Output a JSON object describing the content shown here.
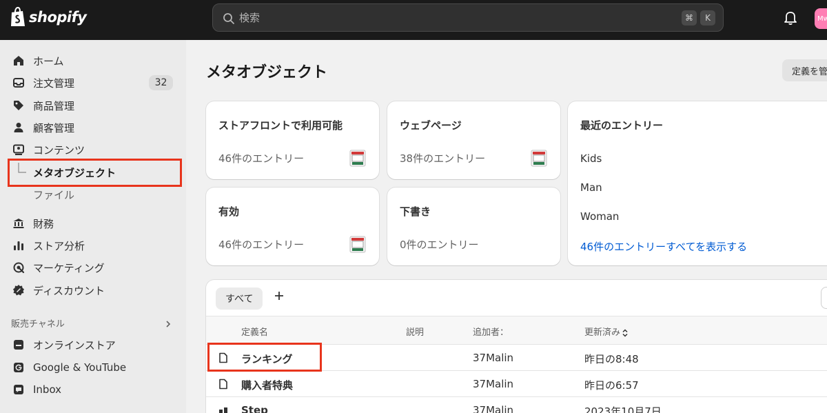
{
  "topbar": {
    "logo_text": "shopify",
    "search_placeholder": "検索",
    "shortcut_cmd": "⌘",
    "shortcut_key": "K",
    "avatar_text": "Mw"
  },
  "sidebar": {
    "items": [
      {
        "label": "ホーム",
        "icon": "home-icon"
      },
      {
        "label": "注文管理",
        "icon": "inbox-icon",
        "badge": "32"
      },
      {
        "label": "商品管理",
        "icon": "tag-icon"
      },
      {
        "label": "顧客管理",
        "icon": "person-icon"
      },
      {
        "label": "コンテンツ",
        "icon": "content-icon"
      },
      {
        "label": "メタオブジェクト"
      },
      {
        "label": "ファイル"
      },
      {
        "label": "財務",
        "icon": "bank-icon"
      },
      {
        "label": "ストア分析",
        "icon": "bar-chart-icon"
      },
      {
        "label": "マーケティング",
        "icon": "target-icon"
      },
      {
        "label": "ディスカウント",
        "icon": "discount-icon"
      }
    ],
    "sales_channels_label": "販売チャネル",
    "channels": [
      {
        "label": "オンラインストア",
        "icon": "store-icon"
      },
      {
        "label": "Google & YouTube",
        "icon": "google-icon"
      },
      {
        "label": "Inbox",
        "icon": "inbox-app-icon"
      }
    ]
  },
  "main": {
    "title": "メタオブジェクト",
    "header_button": "定義を管",
    "cards": [
      {
        "title": "ストアフロントで利用可能",
        "count": "46件のエントリー"
      },
      {
        "title": "ウェブページ",
        "count": "38件のエントリー"
      },
      {
        "title": "有効",
        "count": "46件のエントリー"
      },
      {
        "title": "下書き",
        "count": "0件のエントリー"
      }
    ],
    "recent": {
      "title": "最近のエントリー",
      "entries": [
        "Kids",
        "Man",
        "Woman"
      ],
      "view_all": "46件のエントリーすべてを表示する"
    },
    "table": {
      "tab_all": "すべて",
      "headers": {
        "name": "定義名",
        "description": "説明",
        "added_by": "追加者：",
        "updated": "更新済み"
      },
      "rows": [
        {
          "name": "ランキング",
          "description": "",
          "added_by": "37Malin",
          "updated": "昨日の8:48"
        },
        {
          "name": "購入者特典",
          "description": "",
          "added_by": "37Malin",
          "updated": "昨日の6:57"
        },
        {
          "name": "Step",
          "description": "",
          "added_by": "37Malin",
          "updated": "2023年10月7日"
        }
      ]
    }
  },
  "colors": {
    "topbar_bg": "#1a1a1a",
    "highlight": "#e8341c",
    "link": "#005bd3",
    "avatar": "#ff7eb4"
  }
}
